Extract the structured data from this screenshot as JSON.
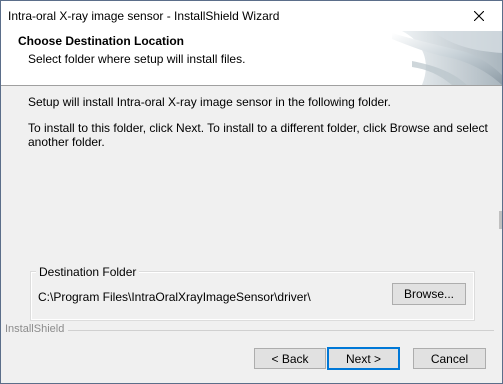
{
  "window": {
    "title": "Intra-oral X-ray image sensor - InstallShield Wizard"
  },
  "header": {
    "title": "Choose Destination Location",
    "subtitle": "Select folder where setup will install files."
  },
  "body": {
    "line1": "Setup will install Intra-oral X-ray image sensor in the following folder.",
    "line2": "To install to this folder, click Next. To install to a different folder, click Browse and select",
    "line3": "another folder."
  },
  "destination": {
    "group_label": "Destination Folder",
    "path": "C:\\Program Files\\IntraOralXrayImageSensor\\driver\\",
    "browse_label": "Browse..."
  },
  "footer": {
    "brand": "InstallShield",
    "back_label": "< Back",
    "next_label": "Next >",
    "cancel_label": "Cancel"
  },
  "icons": {
    "close": "close-icon",
    "header_graphic": "installshield-graphic"
  },
  "colors": {
    "default_button_border": "#0078d7",
    "button_face": "#e1e1e1",
    "dialog_background": "#f0f0f0"
  }
}
